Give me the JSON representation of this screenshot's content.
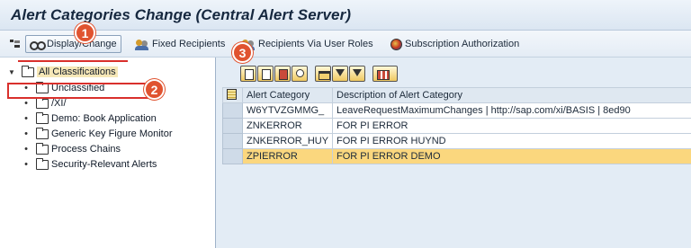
{
  "window": {
    "title": "Alert Categories Change (Central Alert Server)"
  },
  "toolbar": {
    "display_change": "Display/Change",
    "fixed_recipients": "Fixed Recipients",
    "recipients_via_roles": "Recipients Via User Roles",
    "subscription_authorization": "Subscription Authorization"
  },
  "tree": {
    "root": "All Classifications",
    "items": [
      "Unclassified",
      "/XI/",
      "Demo: Book Application",
      "Generic Key Figure Monitor",
      "Process Chains",
      "Security-Relevant Alerts"
    ]
  },
  "table": {
    "columns": [
      "Alert Category",
      "Description of Alert Category"
    ],
    "rows": [
      {
        "category": "W6YTVZGMMG_",
        "description": "LeaveRequestMaximumChanges | http://sap.com/xi/BASIS | 8ed90"
      },
      {
        "category": "ZNKERROR",
        "description": "FOR PI ERROR"
      },
      {
        "category": "ZNKERROR_HUY",
        "description": "FOR PI ERROR HUYND"
      },
      {
        "category": "ZPIERROR",
        "description": "FOR PI ERROR DEMO"
      }
    ],
    "selected_row": 3
  },
  "badges": [
    "1",
    "2",
    "3"
  ],
  "colors": {
    "badge": "#e05330",
    "highlight_row": "#fbd77e",
    "callout_frame": "#d9302c"
  }
}
